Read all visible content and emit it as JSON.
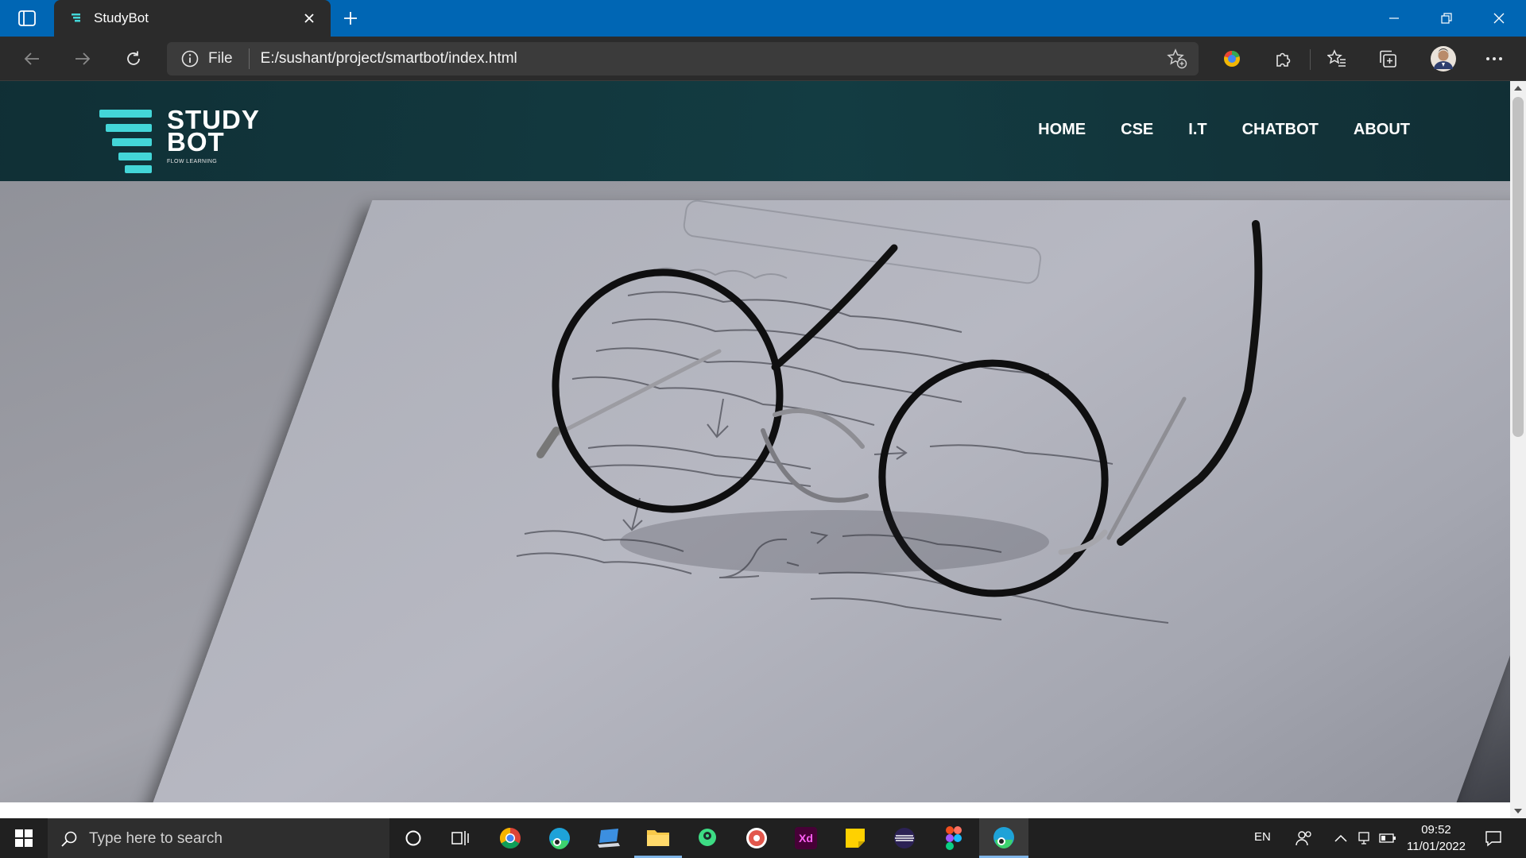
{
  "browser": {
    "tab_title": "StudyBot",
    "address_scheme_label": "File",
    "url": "E:/sushant/project/smartbot/index.html"
  },
  "site": {
    "logo_word1": "STUDY",
    "logo_word2": "BOT",
    "logo_tagline": "FLOW LEARNING",
    "nav": [
      {
        "label": "HOME"
      },
      {
        "label": "CSE"
      },
      {
        "label": "I.T"
      },
      {
        "label": "CHATBOT"
      },
      {
        "label": "ABOUT"
      }
    ],
    "accent_color": "#43d6d8",
    "header_color": "#08343a"
  },
  "taskbar": {
    "search_placeholder": "Type here to search",
    "language": "EN",
    "time": "09:52",
    "date": "11/01/2022"
  },
  "colors": {
    "titlebar": "#0066b4",
    "browser_chrome": "#2b2b2b",
    "taskbar": "#202020"
  }
}
